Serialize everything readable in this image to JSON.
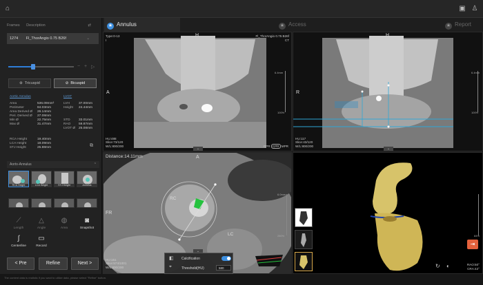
{
  "titlebar": {
    "home_icon": "home-icon",
    "right_icons": [
      "save-icon",
      "user-settings-icon"
    ]
  },
  "series": {
    "headers": [
      "Frames",
      "Description"
    ],
    "row": {
      "frames": "1274",
      "description": "Fl_ThorAngio 0.75 B26f"
    }
  },
  "slider": {
    "position": 0.38
  },
  "valve_types": [
    {
      "label": "Tricuspid",
      "active": false
    },
    {
      "label": "Bicuspid",
      "active": true
    }
  ],
  "aortic_annulus": {
    "title": "Aortic Annulus",
    "lvot_title": "LVOT",
    "rows": [
      {
        "label": "Area",
        "value": "536.09mm²"
      },
      {
        "label": "Perimeter",
        "value": "84.03mm"
      },
      {
        "label": "Area Derived Ø",
        "value": "26.14mm"
      },
      {
        "label": "Peri. Derived Ø",
        "value": "27.08mm"
      },
      {
        "label": "Min Ø",
        "value": "22.75mm"
      },
      {
        "label": "Max Ø",
        "value": "31.47mm"
      }
    ],
    "lvot_rows": [
      {
        "label": "LVH",
        "value": "37.00mm"
      },
      {
        "label": "Height",
        "value": "24.44mm"
      },
      {
        "label": "STD",
        "value": "33.01mm"
      },
      {
        "label": "RAO",
        "value": "59.87mm"
      },
      {
        "label": "LVOT Ø",
        "value": "25.08mm"
      }
    ],
    "heights": [
      {
        "label": "RCA Height",
        "value": "19.40mm"
      },
      {
        "label": "LCA Height",
        "value": "18.09mm"
      },
      {
        "label": "STJ Height",
        "value": "25.88mm"
      }
    ]
  },
  "aorto_annulus": {
    "title": "Aorto-Annulus",
    "thumbs": [
      "RCA Height",
      "LCA Height",
      "STJ Height",
      "Annulus",
      "",
      "",
      "",
      ""
    ]
  },
  "tools": [
    {
      "label": "Length",
      "icon": "ruler-icon",
      "active": false
    },
    {
      "label": "Angle",
      "icon": "angle-icon",
      "active": false
    },
    {
      "label": "Area",
      "icon": "area-icon",
      "active": false
    },
    {
      "label": "Snapshot",
      "icon": "camera-icon",
      "active": true
    },
    {
      "label": "Centerline",
      "icon": "centerline-icon",
      "active": true
    },
    {
      "label": "Record",
      "icon": "video-icon",
      "active": true
    }
  ],
  "nav": {
    "prev": "< Pre",
    "refine": "Refine",
    "next": "Next >"
  },
  "tabs": [
    {
      "label": "Annulus",
      "active": true
    },
    {
      "label": "Access",
      "active": false
    },
    {
      "label": "Report",
      "active": false
    }
  ],
  "views": {
    "tl": {
      "top_left": "Type:0-13",
      "top_left2": "I",
      "top_right": "Fl_ThorAngio 0.75 B26f",
      "top_right2": "CT",
      "side_label": "A",
      "bottom": [
        "HU:488",
        "Slice:73/120",
        "W/L:800/200"
      ],
      "controls": [
        "CPR",
        "CPR",
        "MPR"
      ],
      "scale_top": "6.4mm",
      "scale_bot": "100%"
    },
    "tr": {
      "side_label": "R",
      "bottom": [
        "HU:117",
        "Slice:43/120",
        "W/L:800/200"
      ],
      "scale_top": "6.4mm",
      "scale_bot": "100%"
    },
    "bl": {
      "title": "Distance:14.11mm",
      "side_label": "FR",
      "annot": [
        "RC",
        "LC"
      ],
      "bottom": [
        "HU:151",
        "Slice:574/1001",
        "W/L:800/200"
      ],
      "scale_top": "6.0mm",
      "scale_bot": "280%"
    },
    "br": {
      "angle": [
        "RAO:50°",
        "CRA:42°"
      ],
      "scale_lbl": "84%"
    }
  },
  "calcification": {
    "label": "Calcification",
    "on": true,
    "threshold_label": "Threshold(HU)",
    "threshold_value": "580"
  },
  "footer": "The content data is realistic if you want to utilize data, please select \"Refine\" button.",
  "colors": {
    "accent": "#3d8fe0",
    "green": "#25c23e",
    "orange": "#e4613c",
    "gold": "#d7c36a"
  }
}
